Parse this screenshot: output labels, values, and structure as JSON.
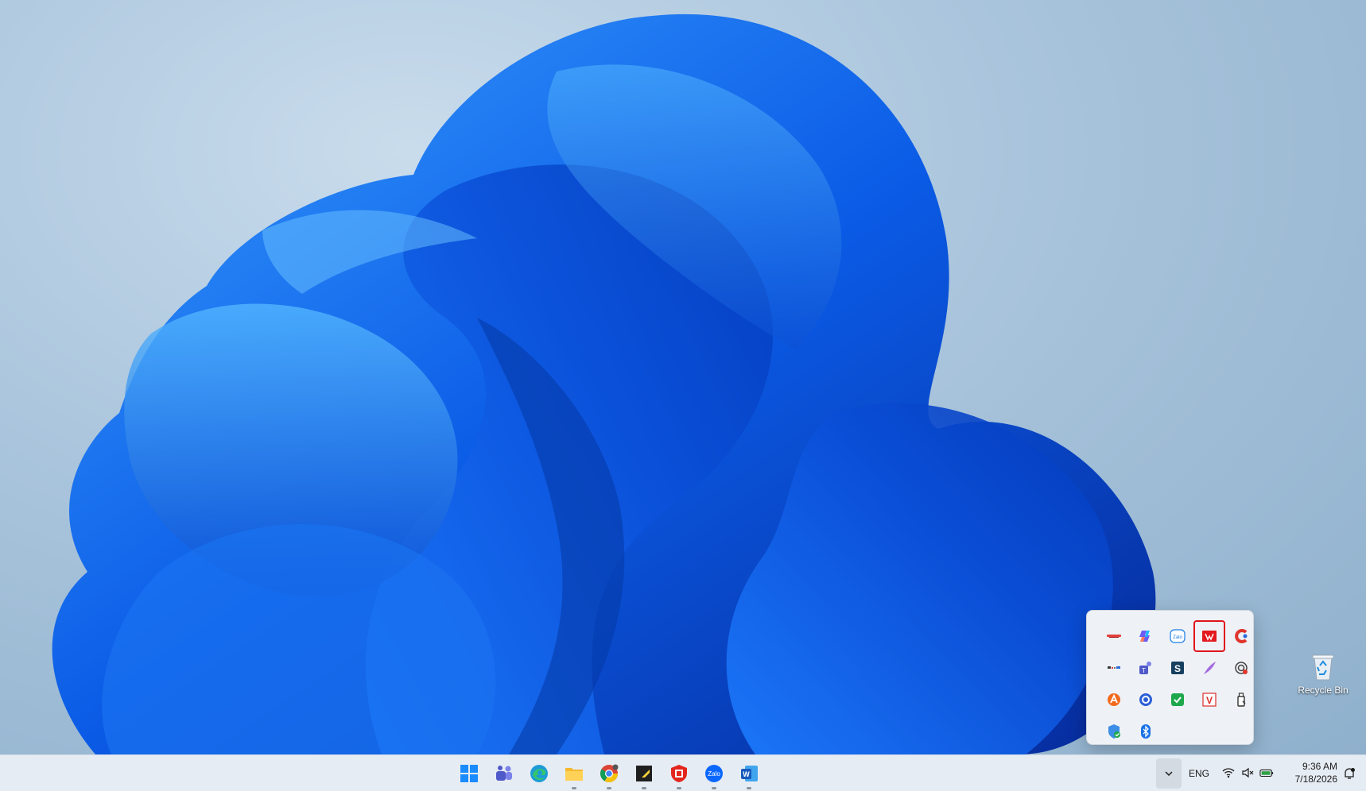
{
  "desktop": {
    "recycle_bin_label": "Recycle Bin"
  },
  "tray_overflow": {
    "icons": [
      {
        "name": "logo-badge-icon"
      },
      {
        "name": "copilot-icon"
      },
      {
        "name": "zalo-icon"
      },
      {
        "name": "red-pdf-app-icon",
        "selected": true
      },
      {
        "name": "ccleaner-icon"
      },
      {
        "name": "keyboard-indicator-icon"
      },
      {
        "name": "teams-icon"
      },
      {
        "name": "s-app-icon"
      },
      {
        "name": "feather-pen-icon"
      },
      {
        "name": "fingerprint-icon"
      },
      {
        "name": "avast-icon"
      },
      {
        "name": "sync-icon"
      },
      {
        "name": "check-shield-icon"
      },
      {
        "name": "v-app-icon"
      },
      {
        "name": "usb-drive-icon"
      },
      {
        "name": "defender-icon"
      },
      {
        "name": "bluetooth-icon"
      }
    ],
    "selected_color": "#e0151b"
  },
  "taskbar": {
    "apps": [
      {
        "name": "start-icon"
      },
      {
        "name": "teams-icon"
      },
      {
        "name": "edge-icon"
      },
      {
        "name": "file-explorer-icon"
      },
      {
        "name": "chrome-icon"
      },
      {
        "name": "sticky-app-icon"
      },
      {
        "name": "shield-app-icon"
      },
      {
        "name": "zalo-icon"
      },
      {
        "name": "word-icon"
      }
    ],
    "zalo_text": "Zalo",
    "word_text": "W",
    "language": "ENG",
    "time": "9:36 AM",
    "date": "7/18/2026"
  }
}
